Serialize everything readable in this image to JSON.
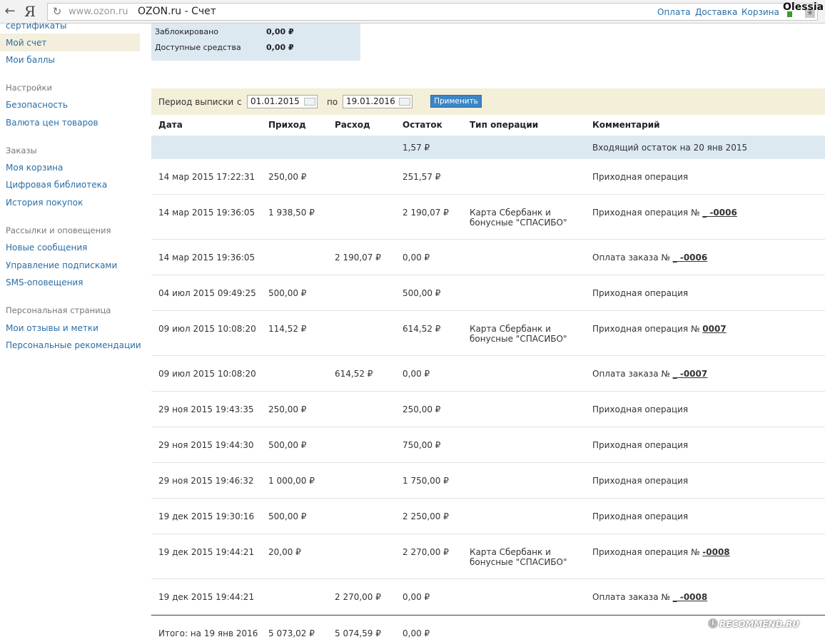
{
  "browser": {
    "back": "←",
    "logo": "Я",
    "reload": "↻",
    "url_host": "www.ozon.ru",
    "title": "OZON.ru - Счет",
    "links": {
      "pay": "Оплата",
      "delivery": "Доставка",
      "cart": "Корзина"
    },
    "user": "Olessia"
  },
  "sidebar": {
    "items": [
      {
        "kind": "item",
        "label": "сертификаты"
      },
      {
        "kind": "item",
        "label": "Мой счет",
        "active": true
      },
      {
        "kind": "item",
        "label": "Мои баллы"
      },
      {
        "kind": "head",
        "label": "Настройки"
      },
      {
        "kind": "item",
        "label": "Безопасность"
      },
      {
        "kind": "item",
        "label": "Валюта цен товаров"
      },
      {
        "kind": "head",
        "label": "Заказы"
      },
      {
        "kind": "item",
        "label": "Моя корзина"
      },
      {
        "kind": "item",
        "label": "Цифровая библиотека"
      },
      {
        "kind": "item",
        "label": "История покупок"
      },
      {
        "kind": "head",
        "label": "Рассылки и оповещения"
      },
      {
        "kind": "item",
        "label": "Новые сообщения"
      },
      {
        "kind": "item",
        "label": "Управление подписками"
      },
      {
        "kind": "item",
        "label": "SMS-оповещения"
      },
      {
        "kind": "head",
        "label": "Персональная страница"
      },
      {
        "kind": "item",
        "label": "Мои отзывы и метки"
      },
      {
        "kind": "item",
        "label": "Персональные рекомендации"
      }
    ]
  },
  "balance": {
    "blocked_label": "Заблокировано",
    "blocked_value": "0,00 ₽",
    "available_label": "Доступные средства",
    "available_value": "0,00 ₽"
  },
  "period": {
    "label": "Период выписки",
    "from_label": "с",
    "from_value": "01.01.2015",
    "to_label": "по",
    "to_value": "19.01.2016",
    "apply": "Применить"
  },
  "table": {
    "headers": {
      "date": "Дата",
      "income": "Приход",
      "expense": "Расход",
      "balance": "Остаток",
      "type": "Тип операции",
      "comment": "Комментарий"
    },
    "opening": {
      "balance": "1,57 ₽",
      "comment": "Входящий остаток на 20 янв 2015"
    },
    "rows": [
      {
        "date": "14 мар 2015 17:22:31",
        "income": "250,00 ₽",
        "expense": "",
        "balance": "251,57 ₽",
        "type": "",
        "comment": "Приходная операция",
        "order": ""
      },
      {
        "date": "14 мар 2015 19:36:05",
        "income": "1 938,50 ₽",
        "expense": "",
        "balance": "2 190,07 ₽",
        "type": "Карта Сбербанк и бонусные \"СПАСИБО\"",
        "comment": "Приходная операция №",
        "order": "_ -0006"
      },
      {
        "date": "14 мар 2015 19:36:05",
        "income": "",
        "expense": "2 190,07 ₽",
        "balance": "0,00 ₽",
        "type": "",
        "comment": "Оплата заказа №",
        "order": "_ -0006"
      },
      {
        "date": "04 июл 2015 09:49:25",
        "income": "500,00 ₽",
        "expense": "",
        "balance": "500,00 ₽",
        "type": "",
        "comment": "Приходная операция",
        "order": ""
      },
      {
        "date": "09 июл 2015 10:08:20",
        "income": "114,52 ₽",
        "expense": "",
        "balance": "614,52 ₽",
        "type": "Карта Сбербанк и бонусные \"СПАСИБО\"",
        "comment": "Приходная операция №",
        "order": "0007"
      },
      {
        "date": "09 июл 2015 10:08:20",
        "income": "",
        "expense": "614,52 ₽",
        "balance": "0,00 ₽",
        "type": "",
        "comment": "Оплата заказа №",
        "order": "_ -0007"
      },
      {
        "date": "29 ноя 2015 19:43:35",
        "income": "250,00 ₽",
        "expense": "",
        "balance": "250,00 ₽",
        "type": "",
        "comment": "Приходная операция",
        "order": ""
      },
      {
        "date": "29 ноя 2015 19:44:30",
        "income": "500,00 ₽",
        "expense": "",
        "balance": "750,00 ₽",
        "type": "",
        "comment": "Приходная операция",
        "order": ""
      },
      {
        "date": "29 ноя 2015 19:46:32",
        "income": "1 000,00 ₽",
        "expense": "",
        "balance": "1 750,00 ₽",
        "type": "",
        "comment": "Приходная операция",
        "order": ""
      },
      {
        "date": "19 дек 2015 19:30:16",
        "income": "500,00 ₽",
        "expense": "",
        "balance": "2 250,00 ₽",
        "type": "",
        "comment": "Приходная операция",
        "order": ""
      },
      {
        "date": "19 дек 2015 19:44:21",
        "income": "20,00 ₽",
        "expense": "",
        "balance": "2 270,00 ₽",
        "type": "Карта Сбербанк и бонусные \"СПАСИБО\"",
        "comment": "Приходная операция №",
        "order": "-0008"
      },
      {
        "date": "19 дек 2015 19:44:21",
        "income": "",
        "expense": "2 270,00 ₽",
        "balance": "0,00 ₽",
        "type": "",
        "comment": "Оплата заказа №",
        "order": "_ -0008"
      }
    ],
    "total": {
      "date": "Итого: на 19 янв 2016",
      "income": "5 073,02 ₽",
      "expense": "5 074,59 ₽",
      "balance": "0,00 ₽"
    }
  },
  "watermark": "RECOMMEND.RU"
}
